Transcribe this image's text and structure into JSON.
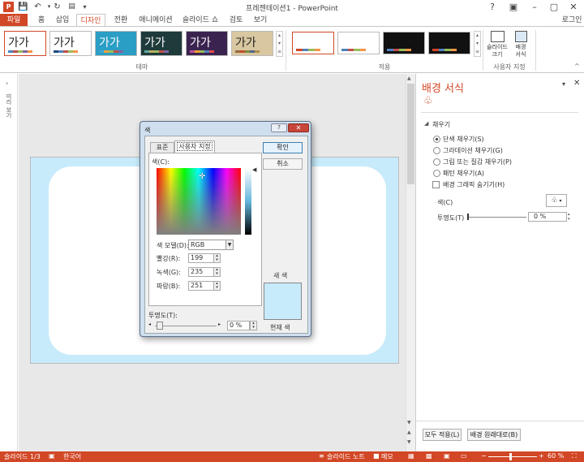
{
  "title_bar": {
    "title": "프레젠테이션1 - PowerPoint",
    "help": "?",
    "login": "로그인",
    "icons": [
      "powerpoint-logo-icon",
      "save-icon",
      "undo-icon",
      "redo-icon",
      "present-icon",
      "customize-icon"
    ]
  },
  "tabs": [
    "파일",
    "홈",
    "삽입",
    "디자인",
    "전환",
    "애니메이션",
    "슬라이드 쇼",
    "검토",
    "보기"
  ],
  "ribbon": {
    "themes": [
      {
        "label": "가가",
        "bg": "#ffffff",
        "fg": "#222222",
        "bars": [
          "#4f81bd",
          "#c0504d",
          "#9bbb59",
          "#8064a2",
          "#f79646"
        ]
      },
      {
        "label": "가가",
        "bg": "#ffffff",
        "fg": "#222222",
        "bars": [
          "#1f497d",
          "#4f81bd",
          "#c0504d",
          "#9bbb59",
          "#f79646"
        ]
      },
      {
        "label": "가가",
        "bg": "#2a9ec4",
        "fg": "#ffffff",
        "bars": [
          "#3aa6d6",
          "#f5a13c",
          "#9bbb59",
          "#c0504d",
          "#8064a2"
        ]
      },
      {
        "label": "가가",
        "bg": "#1f3a3a",
        "fg": "#ffffff",
        "bars": [
          "#5fa8a0",
          "#c0b060",
          "#9bbb59",
          "#c0504d",
          "#8064a2"
        ]
      },
      {
        "label": "가가",
        "bg": "#3b2350",
        "fg": "#ffffff",
        "bars": [
          "#c04f9b",
          "#f0a030",
          "#9bbb59",
          "#4f81bd",
          "#e04a4a"
        ]
      },
      {
        "label": "가가",
        "bg": "#d8c7a0",
        "fg": "#222222",
        "bars": [
          "#9b6a3a",
          "#c04f2a",
          "#7a8a3a",
          "#4f6a8a",
          "#b09050"
        ]
      }
    ],
    "themes_group": "테마",
    "variants": [
      {
        "bg": "#ffffff",
        "bars": [
          "#d24726",
          "#4f81bd",
          "#9bbb59",
          "#f79646"
        ]
      },
      {
        "bg": "#ffffff",
        "bars": [
          "#4f81bd",
          "#c0504d",
          "#9bbb59",
          "#f79646"
        ]
      },
      {
        "bg": "#111111",
        "bars": [
          "#4f81bd",
          "#c0504d",
          "#9bbb59",
          "#f79646"
        ]
      },
      {
        "bg": "#111111",
        "bars": [
          "#d24726",
          "#4f81bd",
          "#9bbb59",
          "#f79646"
        ]
      }
    ],
    "variants_group": "적용",
    "slide_size": "슬라이드\n크기",
    "format_bg": "배경\n서식",
    "customize_group": "사용자 지정"
  },
  "left_strip": {
    "label": "미리 보기"
  },
  "pane": {
    "title": "배경 서식",
    "section": "채우기",
    "options": [
      {
        "label": "단색 채우기(S)",
        "selected": true
      },
      {
        "label": "그라데이션 채우기(G)",
        "selected": false
      },
      {
        "label": "그림 또는 질감 채우기(P)",
        "selected": false
      },
      {
        "label": "패턴 채우기(A)",
        "selected": false
      }
    ],
    "hide_graphics": "배경 그래픽 숨기기(H)",
    "color_label": "색(C)",
    "transparency_label": "투명도(T)",
    "transparency_value": "0 %",
    "apply_all": "모두 적용(L)",
    "reset": "배경 원래대로(B)"
  },
  "dialog": {
    "title": "색",
    "tab_standard": "표준",
    "tab_custom": "사용자 지정",
    "ok": "확인",
    "cancel": "취소",
    "colors_label": "색(C):",
    "model_label": "색 모델(D):",
    "model_value": "RGB",
    "red_label": "빨강(R):",
    "red": "199",
    "green_label": "녹색(G):",
    "green": "235",
    "blue_label": "파랑(B):",
    "blue": "251",
    "new_label": "새 색",
    "current_label": "현재 색",
    "transparency_label": "투명도(T):",
    "transparency_value": "0 %",
    "new_color": "#c7ebfb"
  },
  "status": {
    "slide": "슬라이드 1/3",
    "language": "한국어",
    "notes": "슬라이드 노트",
    "comments": "메모",
    "zoom": "60 %"
  }
}
